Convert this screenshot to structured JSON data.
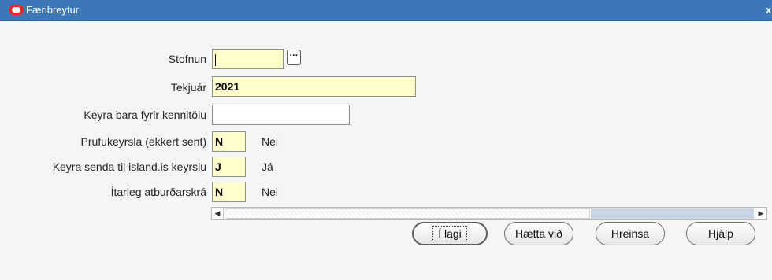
{
  "window": {
    "title": "Færibreytur",
    "close_glyph": "x"
  },
  "fields": [
    {
      "label": "Stofnun",
      "value": "",
      "has_lov": true,
      "lov_glyph": "···"
    },
    {
      "label": "Tekjuár",
      "value": "2021"
    },
    {
      "label": "Keyra bara fyrir kennitölu",
      "value": ""
    },
    {
      "label": "Prufukeyrsla (ekkert sent)",
      "value": "N",
      "description": "Nei"
    },
    {
      "label": "Keyra senda til island.is keyrslu",
      "value": "J",
      "description": "Já"
    },
    {
      "label": "Ítarleg atburðarskrá",
      "value": "N",
      "description": "Nei"
    }
  ],
  "scrollbar": {
    "left_arrow": "◀",
    "right_arrow": "▶"
  },
  "buttons": {
    "ok": "Í lagi",
    "cancel": "Hætta við",
    "clear": "Hreinsa",
    "help": "Hjálp"
  },
  "colors": {
    "titlebar": "#3c78b8",
    "required_field": "#ffffcc",
    "logo": "#e32b2b"
  }
}
